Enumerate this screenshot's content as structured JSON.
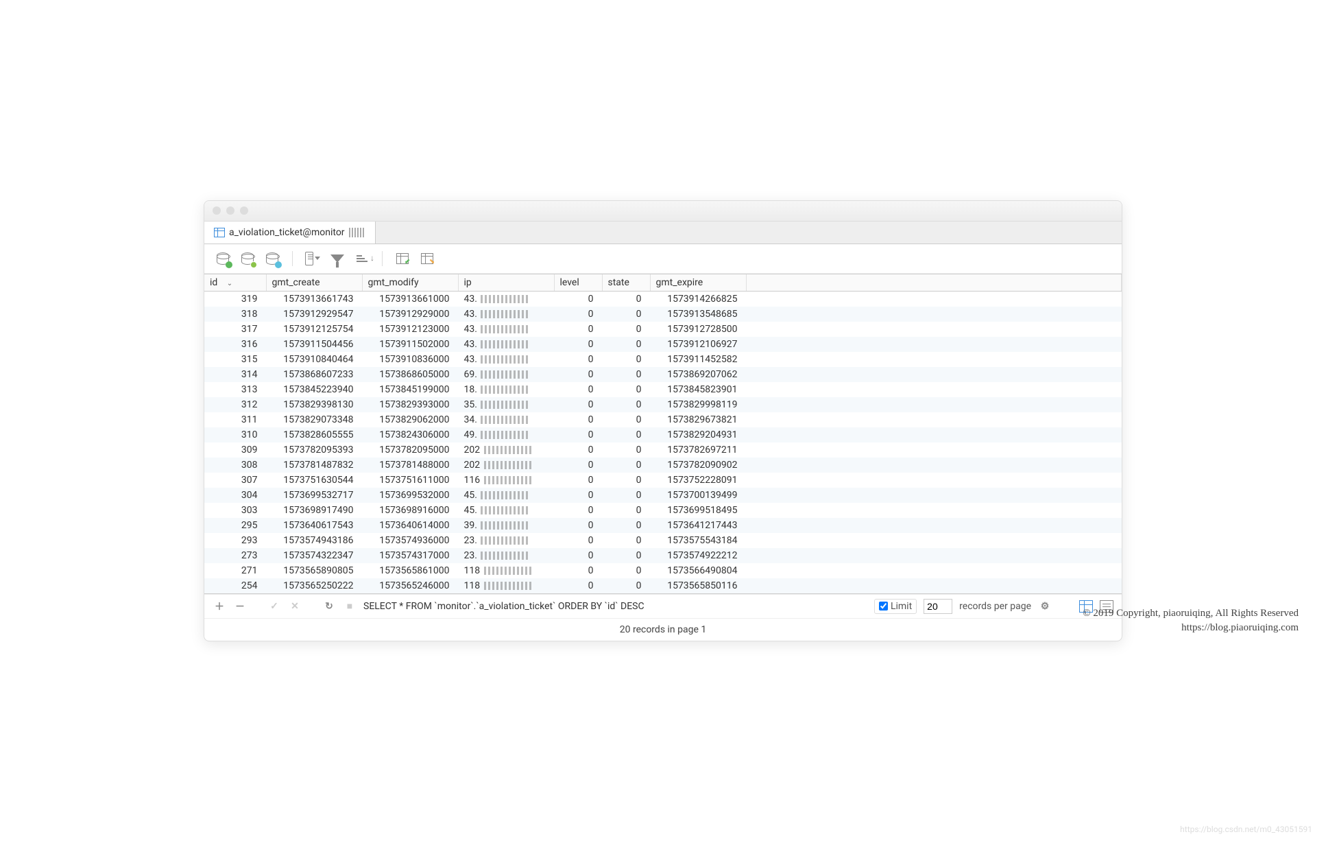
{
  "tab": {
    "title": "a_violation_ticket@monitor"
  },
  "columns": [
    "id",
    "gmt_create",
    "gmt_modify",
    "ip",
    "level",
    "state",
    "gmt_expire"
  ],
  "sort": {
    "column": "id",
    "direction": "desc"
  },
  "rows": [
    {
      "id": 319,
      "gmt_create": "1573913661743",
      "gmt_modify": "1573913661000",
      "ip_prefix": "43.",
      "level": 0,
      "state": 0,
      "gmt_expire": "1573914266825"
    },
    {
      "id": 318,
      "gmt_create": "1573912929547",
      "gmt_modify": "1573912929000",
      "ip_prefix": "43.",
      "level": 0,
      "state": 0,
      "gmt_expire": "1573913548685"
    },
    {
      "id": 317,
      "gmt_create": "1573912125754",
      "gmt_modify": "1573912123000",
      "ip_prefix": "43.",
      "level": 0,
      "state": 0,
      "gmt_expire": "1573912728500"
    },
    {
      "id": 316,
      "gmt_create": "1573911504456",
      "gmt_modify": "1573911502000",
      "ip_prefix": "43.",
      "level": 0,
      "state": 0,
      "gmt_expire": "1573912106927"
    },
    {
      "id": 315,
      "gmt_create": "1573910840464",
      "gmt_modify": "1573910836000",
      "ip_prefix": "43.",
      "level": 0,
      "state": 0,
      "gmt_expire": "1573911452582"
    },
    {
      "id": 314,
      "gmt_create": "1573868607233",
      "gmt_modify": "1573868605000",
      "ip_prefix": "69.",
      "level": 0,
      "state": 0,
      "gmt_expire": "1573869207062"
    },
    {
      "id": 313,
      "gmt_create": "1573845223940",
      "gmt_modify": "1573845199000",
      "ip_prefix": "18.",
      "level": 0,
      "state": 0,
      "gmt_expire": "1573845823901"
    },
    {
      "id": 312,
      "gmt_create": "1573829398130",
      "gmt_modify": "1573829393000",
      "ip_prefix": "35.",
      "level": 0,
      "state": 0,
      "gmt_expire": "1573829998119"
    },
    {
      "id": 311,
      "gmt_create": "1573829073348",
      "gmt_modify": "1573829062000",
      "ip_prefix": "34.",
      "level": 0,
      "state": 0,
      "gmt_expire": "1573829673821"
    },
    {
      "id": 310,
      "gmt_create": "1573828605555",
      "gmt_modify": "1573824306000",
      "ip_prefix": "49.",
      "level": 0,
      "state": 0,
      "gmt_expire": "1573829204931"
    },
    {
      "id": 309,
      "gmt_create": "1573782095393",
      "gmt_modify": "1573782095000",
      "ip_prefix": "202",
      "level": 0,
      "state": 0,
      "gmt_expire": "1573782697211"
    },
    {
      "id": 308,
      "gmt_create": "1573781487832",
      "gmt_modify": "1573781488000",
      "ip_prefix": "202",
      "level": 0,
      "state": 0,
      "gmt_expire": "1573782090902"
    },
    {
      "id": 307,
      "gmt_create": "1573751630544",
      "gmt_modify": "1573751611000",
      "ip_prefix": "116",
      "level": 0,
      "state": 0,
      "gmt_expire": "1573752228091"
    },
    {
      "id": 304,
      "gmt_create": "1573699532717",
      "gmt_modify": "1573699532000",
      "ip_prefix": "45.",
      "level": 0,
      "state": 0,
      "gmt_expire": "1573700139499"
    },
    {
      "id": 303,
      "gmt_create": "1573698917490",
      "gmt_modify": "1573698916000",
      "ip_prefix": "45.",
      "level": 0,
      "state": 0,
      "gmt_expire": "1573699518495"
    },
    {
      "id": 295,
      "gmt_create": "1573640617543",
      "gmt_modify": "1573640614000",
      "ip_prefix": "39.",
      "level": 0,
      "state": 0,
      "gmt_expire": "1573641217443"
    },
    {
      "id": 293,
      "gmt_create": "1573574943186",
      "gmt_modify": "1573574936000",
      "ip_prefix": "23.",
      "level": 0,
      "state": 0,
      "gmt_expire": "1573575543184"
    },
    {
      "id": 273,
      "gmt_create": "1573574322347",
      "gmt_modify": "1573574317000",
      "ip_prefix": "23.",
      "level": 0,
      "state": 0,
      "gmt_expire": "1573574922212"
    },
    {
      "id": 271,
      "gmt_create": "1573565890805",
      "gmt_modify": "1573565861000",
      "ip_prefix": "118",
      "level": 0,
      "state": 0,
      "gmt_expire": "1573566490804"
    },
    {
      "id": 254,
      "gmt_create": "1573565250222",
      "gmt_modify": "1573565246000",
      "ip_prefix": "118",
      "level": 0,
      "state": 0,
      "gmt_expire": "1573565850116"
    }
  ],
  "footer": {
    "sql": "SELECT * FROM `monitor`.`a_violation_ticket` ORDER BY `id` DESC",
    "limit_label": "Limit",
    "limit_value": "20",
    "records_label": "records per page",
    "status": "20 records in page 1"
  },
  "watermark": {
    "line1": "© 2019 Copyright,  piaoruiqing,  All Rights Reserved",
    "line2": "https://blog.piaoruiqing.com"
  },
  "faint_watermark": "https://blog.csdn.net/m0_43051591"
}
